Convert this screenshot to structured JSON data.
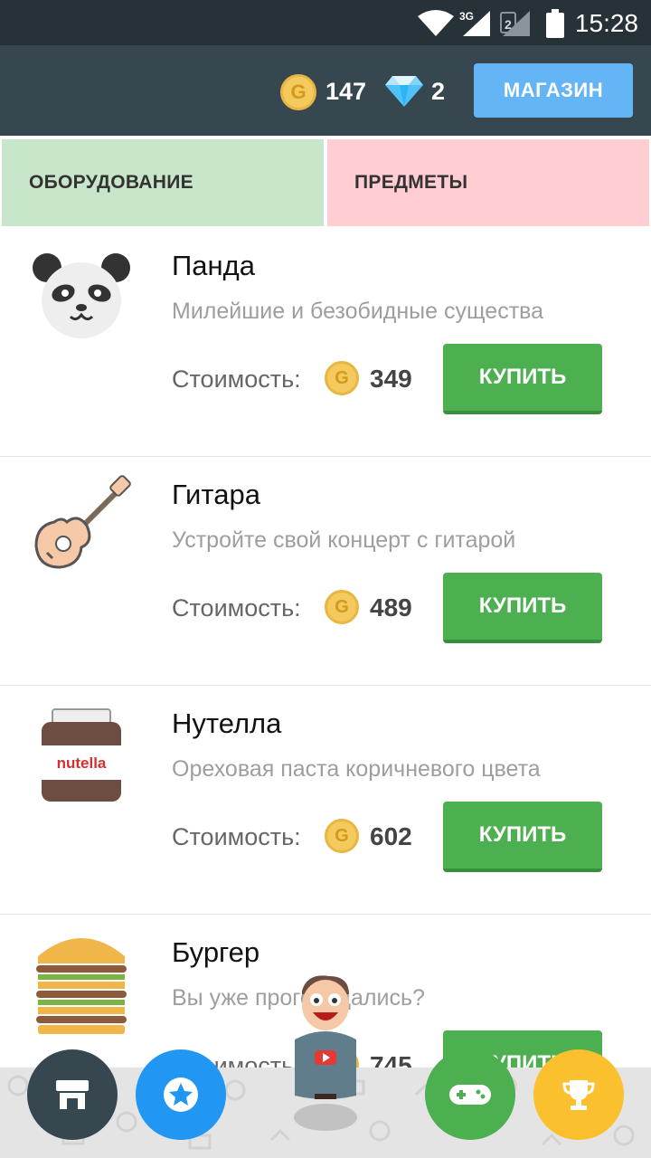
{
  "status_bar": {
    "network_label": "3G",
    "sim_label": "2",
    "time": "15:28"
  },
  "header": {
    "coin_symbol": "G",
    "gold": "147",
    "gems": "2",
    "shop_label": "МАГАЗИН"
  },
  "tabs": [
    {
      "label": "ОБОРУДОВАНИЕ",
      "color": "#c8e6c9"
    },
    {
      "label": "ПРЕДМЕТЫ",
      "color": "#ffcdd2"
    }
  ],
  "items": [
    {
      "name": "Панда",
      "description": "Милейшие и безобидные существа",
      "cost_label": "Стоимость:",
      "coin_symbol": "G",
      "price": "349",
      "buy_label": "КУПИТЬ",
      "icon": "panda-icon"
    },
    {
      "name": "Гитара",
      "description": "Устройте свой концерт с гитарой",
      "cost_label": "Стоимость:",
      "coin_symbol": "G",
      "price": "489",
      "buy_label": "КУПИТЬ",
      "icon": "guitar-icon"
    },
    {
      "name": "Нутелла",
      "description": "Ореховая паста коричневого цвета",
      "cost_label": "Стоимость:",
      "coin_symbol": "G",
      "price": "602",
      "buy_label": "КУПИТЬ",
      "icon": "nutella-icon",
      "jar_label": "nutella"
    },
    {
      "name": "Бургер",
      "description": "Вы уже проголодались?",
      "cost_label": "Стоимость:",
      "coin_symbol": "G",
      "price": "745",
      "buy_label": "КУПИТЬ",
      "icon": "burger-icon"
    }
  ],
  "bottom_nav": [
    {
      "icon": "store-icon",
      "color": "#37474f"
    },
    {
      "icon": "star-icon",
      "color": "#2196f3"
    },
    {
      "icon": "gamepad-icon",
      "color": "#4caf50"
    },
    {
      "icon": "trophy-icon",
      "color": "#fbc02d"
    }
  ],
  "colors": {
    "header_bg": "#37474f",
    "status_bg": "#263238",
    "buy_button": "#4caf50",
    "shop_button": "#64b5f6",
    "coin": "#f4c95d"
  }
}
